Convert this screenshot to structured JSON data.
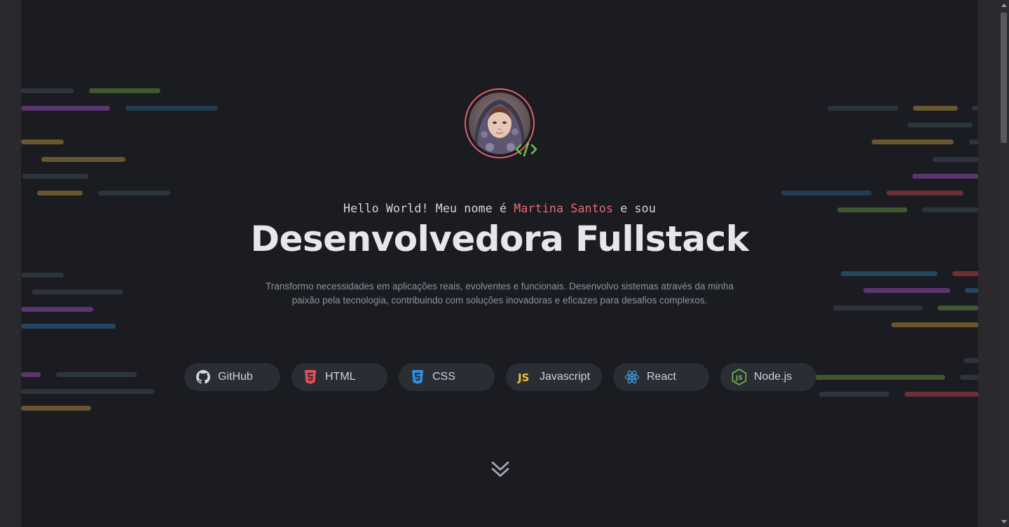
{
  "hero": {
    "greeting_prefix": "Hello World! Meu nome é",
    "name": "Martina Santos",
    "greeting_suffix": "e sou",
    "headline": "Desenvolvedora Fullstack",
    "description": "Transformo necessidades em aplicações reais, evolventes e funcionais. Desenvolvo sistemas através da minha paixão pela tecnologia, contribuindo com soluções inovadoras e eficazes para desafios complexos."
  },
  "skills": [
    {
      "label": "GitHub",
      "icon": "github-icon"
    },
    {
      "label": "HTML",
      "icon": "html5-icon"
    },
    {
      "label": "CSS",
      "icon": "css3-icon"
    },
    {
      "label": "Javascript",
      "icon": "javascript-icon"
    },
    {
      "label": "React",
      "icon": "react-icon"
    },
    {
      "label": "Node.js",
      "icon": "nodejs-icon"
    }
  ],
  "colors": {
    "accent": "#ec6a73",
    "background": "#1b1c21",
    "chip": "#2b2d34",
    "code_badge": "#6cc04a"
  }
}
